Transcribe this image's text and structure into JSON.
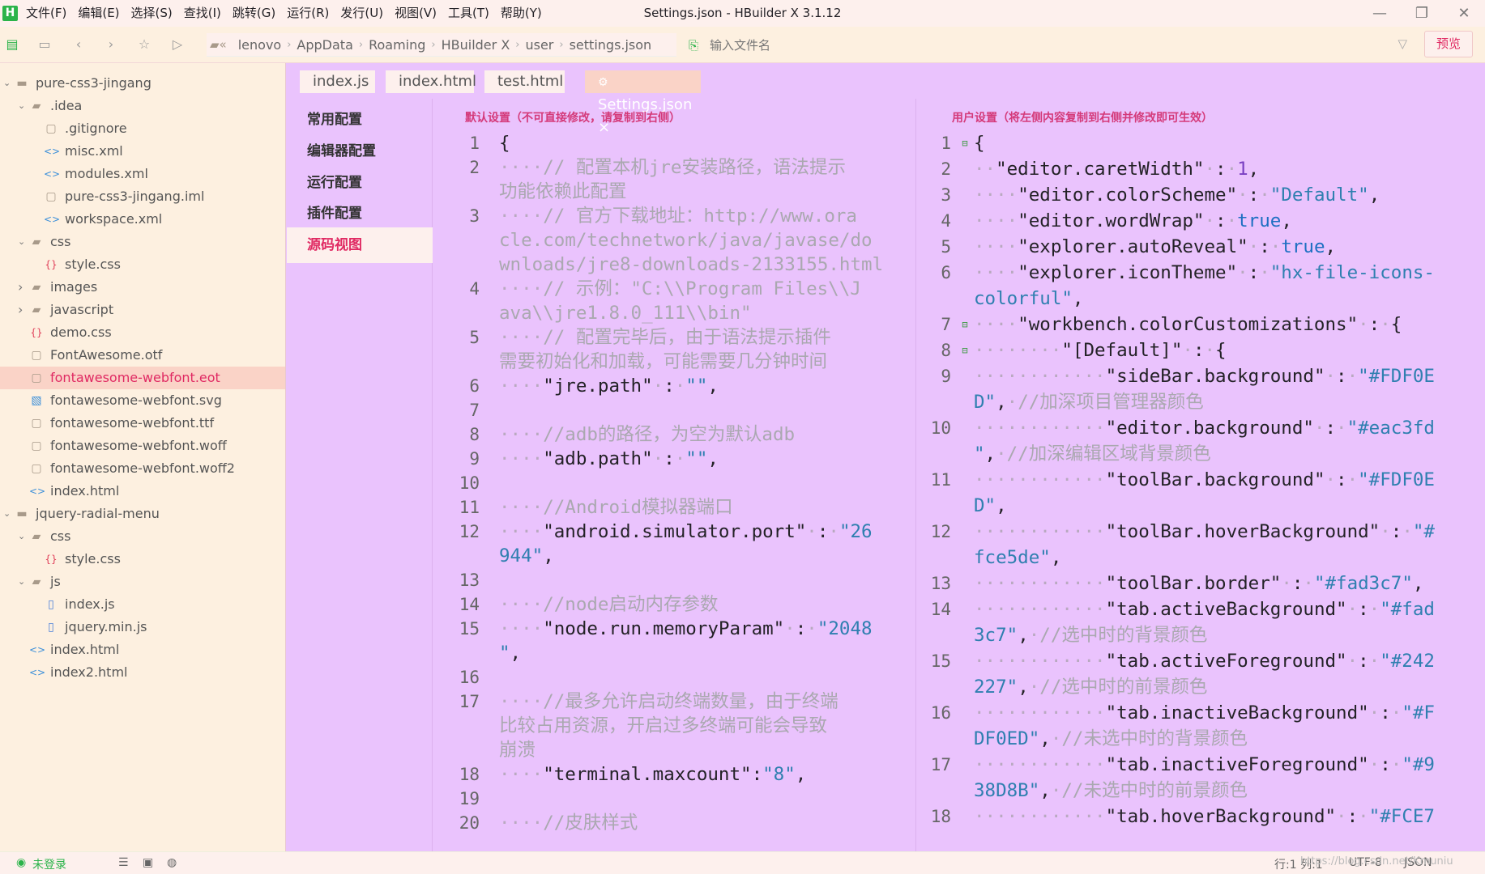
{
  "app": {
    "logo": "H",
    "title": "Settings.json - HBuilder X 3.1.12"
  },
  "menu": [
    "文件(F)",
    "编辑(E)",
    "选择(S)",
    "查找(I)",
    "跳转(G)",
    "运行(R)",
    "发行(U)",
    "视图(V)",
    "工具(T)",
    "帮助(Y)"
  ],
  "breadcrumb": [
    "lenovo",
    "AppData",
    "Roaming",
    "HBuilder X",
    "user",
    "settings.json"
  ],
  "search_placeholder": "输入文件名",
  "preview_label": "预览",
  "tree": [
    {
      "label": "pure-css3-jingang",
      "depth": 0,
      "type": "project",
      "open": true
    },
    {
      "label": ".idea",
      "depth": 1,
      "type": "folder",
      "open": true
    },
    {
      "label": ".gitignore",
      "depth": 2,
      "type": "file"
    },
    {
      "label": "misc.xml",
      "depth": 2,
      "type": "code"
    },
    {
      "label": "modules.xml",
      "depth": 2,
      "type": "code"
    },
    {
      "label": "pure-css3-jingang.iml",
      "depth": 2,
      "type": "file"
    },
    {
      "label": "workspace.xml",
      "depth": 2,
      "type": "code"
    },
    {
      "label": "css",
      "depth": 1,
      "type": "folder",
      "open": true
    },
    {
      "label": "style.css",
      "depth": 2,
      "type": "css"
    },
    {
      "label": "images",
      "depth": 1,
      "type": "folder",
      "open": false
    },
    {
      "label": "javascript",
      "depth": 1,
      "type": "folder",
      "open": false
    },
    {
      "label": "demo.css",
      "depth": 1,
      "type": "css"
    },
    {
      "label": "FontAwesome.otf",
      "depth": 1,
      "type": "file"
    },
    {
      "label": "fontawesome-webfont.eot",
      "depth": 1,
      "type": "file",
      "selected": true
    },
    {
      "label": "fontawesome-webfont.svg",
      "depth": 1,
      "type": "image"
    },
    {
      "label": "fontawesome-webfont.ttf",
      "depth": 1,
      "type": "file"
    },
    {
      "label": "fontawesome-webfont.woff",
      "depth": 1,
      "type": "file"
    },
    {
      "label": "fontawesome-webfont.woff2",
      "depth": 1,
      "type": "file"
    },
    {
      "label": "index.html",
      "depth": 1,
      "type": "code"
    },
    {
      "label": "jquery-radial-menu",
      "depth": 0,
      "type": "project",
      "open": true
    },
    {
      "label": "css",
      "depth": 1,
      "type": "folder",
      "open": true
    },
    {
      "label": "style.css",
      "depth": 2,
      "type": "css"
    },
    {
      "label": "js",
      "depth": 1,
      "type": "folder",
      "open": true
    },
    {
      "label": "index.js",
      "depth": 2,
      "type": "js"
    },
    {
      "label": "jquery.min.js",
      "depth": 2,
      "type": "js"
    },
    {
      "label": "index.html",
      "depth": 1,
      "type": "code"
    },
    {
      "label": "index2.html",
      "depth": 1,
      "type": "code"
    }
  ],
  "tabs": [
    {
      "label": "index.js"
    },
    {
      "label": "index.html"
    },
    {
      "label": "test.html"
    },
    {
      "label": "Settings.json",
      "active": true,
      "icon": "⚙",
      "close": "×"
    }
  ],
  "nav": [
    {
      "label": "常用配置"
    },
    {
      "label": "编辑器配置"
    },
    {
      "label": "运行配置"
    },
    {
      "label": "插件配置"
    },
    {
      "label": "源码视图",
      "active": true
    }
  ],
  "left_title": "默认设置（不可直接修改，请复制到右侧）",
  "right_title": "用户设置（将左侧内容复制到右侧并修改即可生效）",
  "status": {
    "login": "未登录",
    "position": "行:1  列:1",
    "encoding": "UTF-8",
    "syntax": "JSON",
    "watermark": "https://blog.csdn.net/Kmuniu"
  },
  "colors": {
    "sidebar_bg": "#FDF0E0",
    "editor_bg": "#eac3fd",
    "toolbar_bg": "#FDF0E0",
    "hover_bg": "#fce5de",
    "border": "#fad3c7",
    "active_bg": "#fad3c7",
    "active_fg": "#242227",
    "inactive_bg": "#FDF0ED",
    "inactive_fg": "#938D8B",
    "accent": "#e02a63"
  },
  "left_code": [
    {
      "n": "1",
      "parts": [
        [
          "g",
          "{"
        ]
      ]
    },
    {
      "n": "2",
      "parts": [
        [
          "d",
          "····"
        ],
        [
          "c",
          "// 配置本机jre安装路径，语法提示"
        ]
      ]
    },
    {
      "parts": [
        [
          "c",
          "功能依赖此配置"
        ]
      ]
    },
    {
      "n": "3",
      "parts": [
        [
          "d",
          "····"
        ],
        [
          "c",
          "// 官方下载地址：http://www.ora"
        ]
      ]
    },
    {
      "parts": [
        [
          "c",
          "cle.com/technetwork/java/javase/do"
        ]
      ]
    },
    {
      "parts": [
        [
          "c",
          "wnloads/jre8-downloads-2133155.html"
        ]
      ]
    },
    {
      "n": "4",
      "parts": [
        [
          "d",
          "····"
        ],
        [
          "c",
          "// 示例：\"C:\\\\Program Files\\\\J"
        ]
      ]
    },
    {
      "parts": [
        [
          "c",
          "ava\\\\jre1.8.0_111\\\\bin\""
        ]
      ]
    },
    {
      "n": "5",
      "parts": [
        [
          "d",
          "····"
        ],
        [
          "c",
          "// 配置完毕后，由于语法提示插件"
        ]
      ]
    },
    {
      "parts": [
        [
          "c",
          "需要初始化和加载，可能需要几分钟时间"
        ]
      ]
    },
    {
      "n": "6",
      "parts": [
        [
          "d",
          "····"
        ],
        [
          "g",
          "\"jre.path\""
        ],
        [
          "d",
          "·"
        ],
        [
          "g",
          ":"
        ],
        [
          "d",
          "·"
        ],
        [
          "s",
          "\"\""
        ],
        [
          "g",
          ","
        ]
      ]
    },
    {
      "n": "7",
      "parts": []
    },
    {
      "n": "8",
      "parts": [
        [
          "d",
          "····"
        ],
        [
          "c",
          "//adb的路径，为空为默认adb"
        ]
      ]
    },
    {
      "n": "9",
      "parts": [
        [
          "d",
          "····"
        ],
        [
          "g",
          "\"adb.path\""
        ],
        [
          "d",
          "·"
        ],
        [
          "g",
          ":"
        ],
        [
          "d",
          "·"
        ],
        [
          "s",
          "\"\""
        ],
        [
          "g",
          ","
        ]
      ]
    },
    {
      "n": "10",
      "parts": []
    },
    {
      "n": "11",
      "parts": [
        [
          "d",
          "····"
        ],
        [
          "c",
          "//Android模拟器端口"
        ]
      ]
    },
    {
      "n": "12",
      "parts": [
        [
          "d",
          "····"
        ],
        [
          "g",
          "\"android.simulator.port\""
        ],
        [
          "d",
          "·"
        ],
        [
          "g",
          ":"
        ],
        [
          "d",
          "·"
        ],
        [
          "s",
          "\"26"
        ]
      ]
    },
    {
      "parts": [
        [
          "s",
          "944\""
        ],
        [
          "g",
          ","
        ]
      ]
    },
    {
      "n": "13",
      "parts": []
    },
    {
      "n": "14",
      "parts": [
        [
          "d",
          "····"
        ],
        [
          "c",
          "//node启动内存参数"
        ]
      ]
    },
    {
      "n": "15",
      "parts": [
        [
          "d",
          "····"
        ],
        [
          "g",
          "\"node.run.memoryParam\""
        ],
        [
          "d",
          "·"
        ],
        [
          "g",
          ":"
        ],
        [
          "d",
          "·"
        ],
        [
          "s",
          "\"2048"
        ]
      ]
    },
    {
      "parts": [
        [
          "s",
          "\""
        ],
        [
          "g",
          ","
        ]
      ]
    },
    {
      "n": "16",
      "parts": []
    },
    {
      "n": "17",
      "parts": [
        [
          "d",
          "····"
        ],
        [
          "c",
          "//最多允许启动终端数量，由于终端"
        ]
      ]
    },
    {
      "parts": [
        [
          "c",
          "比较占用资源，开启过多终端可能会导致"
        ]
      ]
    },
    {
      "parts": [
        [
          "c",
          "崩溃"
        ]
      ]
    },
    {
      "n": "18",
      "parts": [
        [
          "d",
          "····"
        ],
        [
          "g",
          "\"terminal.maxcount\""
        ],
        [
          "g",
          ":"
        ],
        [
          "s",
          "\"8\""
        ],
        [
          "g",
          ","
        ]
      ]
    },
    {
      "n": "19",
      "parts": []
    },
    {
      "n": "20",
      "parts": [
        [
          "d",
          "····"
        ],
        [
          "c",
          "//皮肤样式"
        ]
      ]
    }
  ],
  "right_code": [
    {
      "n": "1",
      "f": "⊟",
      "parts": [
        [
          "g",
          "{"
        ]
      ]
    },
    {
      "n": "2",
      "parts": [
        [
          "d",
          "··"
        ],
        [
          "g",
          "\"editor.caretWidth\""
        ],
        [
          "d",
          "·"
        ],
        [
          "g",
          ":"
        ],
        [
          "d",
          "·"
        ],
        [
          "n",
          "1"
        ],
        [
          "g",
          ","
        ]
      ]
    },
    {
      "n": "3",
      "parts": [
        [
          "d",
          "····"
        ],
        [
          "g",
          "\"editor.colorScheme\""
        ],
        [
          "d",
          "·"
        ],
        [
          "g",
          ":"
        ],
        [
          "d",
          "·"
        ],
        [
          "s",
          "\"Default\""
        ],
        [
          "g",
          ","
        ]
      ]
    },
    {
      "n": "4",
      "parts": [
        [
          "d",
          "····"
        ],
        [
          "g",
          "\"editor.wordWrap\""
        ],
        [
          "d",
          "·"
        ],
        [
          "g",
          ":"
        ],
        [
          "d",
          "·"
        ],
        [
          "k",
          "true"
        ],
        [
          "g",
          ","
        ]
      ]
    },
    {
      "n": "5",
      "parts": [
        [
          "d",
          "····"
        ],
        [
          "g",
          "\"explorer.autoReveal\""
        ],
        [
          "d",
          "·"
        ],
        [
          "g",
          ":"
        ],
        [
          "d",
          "·"
        ],
        [
          "k",
          "true"
        ],
        [
          "g",
          ","
        ]
      ]
    },
    {
      "n": "6",
      "parts": [
        [
          "d",
          "····"
        ],
        [
          "g",
          "\"explorer.iconTheme\""
        ],
        [
          "d",
          "·"
        ],
        [
          "g",
          ":"
        ],
        [
          "d",
          "·"
        ],
        [
          "s",
          "\"hx-file-icons-"
        ]
      ]
    },
    {
      "parts": [
        [
          "s",
          "colorful\""
        ],
        [
          "g",
          ","
        ]
      ]
    },
    {
      "n": "7",
      "f": "⊟",
      "parts": [
        [
          "d",
          "····"
        ],
        [
          "g",
          "\"workbench.colorCustomizations\""
        ],
        [
          "d",
          "·"
        ],
        [
          "g",
          ":"
        ],
        [
          "d",
          "·"
        ],
        [
          "g",
          "{"
        ]
      ]
    },
    {
      "n": "8",
      "f": "⊟",
      "parts": [
        [
          "d",
          "········"
        ],
        [
          "g",
          "\"[Default]\""
        ],
        [
          "d",
          "·"
        ],
        [
          "g",
          ":"
        ],
        [
          "d",
          "·"
        ],
        [
          "g",
          "{"
        ]
      ]
    },
    {
      "n": "9",
      "parts": [
        [
          "d",
          "············"
        ],
        [
          "g",
          "\"sideBar.background\""
        ],
        [
          "d",
          "·"
        ],
        [
          "g",
          ":"
        ],
        [
          "d",
          "·"
        ],
        [
          "s",
          "\"#FDF0E"
        ]
      ]
    },
    {
      "parts": [
        [
          "s",
          "D\""
        ],
        [
          "g",
          ","
        ],
        [
          "d",
          "·"
        ],
        [
          "c",
          "//加深项目管理器颜色"
        ]
      ]
    },
    {
      "n": "10",
      "parts": [
        [
          "d",
          "············"
        ],
        [
          "g",
          "\"editor.background\""
        ],
        [
          "d",
          "·"
        ],
        [
          "g",
          ":"
        ],
        [
          "d",
          "·"
        ],
        [
          "s",
          "\"#eac3fd"
        ]
      ]
    },
    {
      "parts": [
        [
          "s",
          "\""
        ],
        [
          "g",
          ","
        ],
        [
          "d",
          "·"
        ],
        [
          "c",
          "//加深编辑区域背景颜色"
        ]
      ]
    },
    {
      "n": "11",
      "parts": [
        [
          "d",
          "············"
        ],
        [
          "g",
          "\"toolBar.background\""
        ],
        [
          "d",
          "·"
        ],
        [
          "g",
          ":"
        ],
        [
          "d",
          "·"
        ],
        [
          "s",
          "\"#FDF0E"
        ]
      ]
    },
    {
      "parts": [
        [
          "s",
          "D\""
        ],
        [
          "g",
          ","
        ]
      ]
    },
    {
      "n": "12",
      "parts": [
        [
          "d",
          "············"
        ],
        [
          "g",
          "\"toolBar.hoverBackground\""
        ],
        [
          "d",
          "·"
        ],
        [
          "g",
          ":"
        ],
        [
          "d",
          "·"
        ],
        [
          "s",
          "\"#"
        ]
      ]
    },
    {
      "parts": [
        [
          "s",
          "fce5de\""
        ],
        [
          "g",
          ","
        ]
      ]
    },
    {
      "n": "13",
      "parts": [
        [
          "d",
          "············"
        ],
        [
          "g",
          "\"toolBar.border\""
        ],
        [
          "d",
          "·"
        ],
        [
          "g",
          ":"
        ],
        [
          "d",
          "·"
        ],
        [
          "s",
          "\"#fad3c7\""
        ],
        [
          "g",
          ","
        ]
      ]
    },
    {
      "n": "14",
      "parts": [
        [
          "d",
          "············"
        ],
        [
          "g",
          "\"tab.activeBackground\""
        ],
        [
          "d",
          "·"
        ],
        [
          "g",
          ":"
        ],
        [
          "d",
          "·"
        ],
        [
          "s",
          "\"#fad"
        ]
      ]
    },
    {
      "parts": [
        [
          "s",
          "3c7\""
        ],
        [
          "g",
          ","
        ],
        [
          "d",
          "·"
        ],
        [
          "c",
          "//选中时的背景颜色"
        ]
      ]
    },
    {
      "n": "15",
      "parts": [
        [
          "d",
          "············"
        ],
        [
          "g",
          "\"tab.activeForeground\""
        ],
        [
          "d",
          "·"
        ],
        [
          "g",
          ":"
        ],
        [
          "d",
          "·"
        ],
        [
          "s",
          "\"#242"
        ]
      ]
    },
    {
      "parts": [
        [
          "s",
          "227\""
        ],
        [
          "g",
          ","
        ],
        [
          "d",
          "·"
        ],
        [
          "c",
          "//选中时的前景颜色"
        ]
      ]
    },
    {
      "n": "16",
      "parts": [
        [
          "d",
          "············"
        ],
        [
          "g",
          "\"tab.inactiveBackground\""
        ],
        [
          "d",
          "·"
        ],
        [
          "g",
          ":"
        ],
        [
          "d",
          "·"
        ],
        [
          "s",
          "\"#F"
        ]
      ]
    },
    {
      "parts": [
        [
          "s",
          "DF0ED\""
        ],
        [
          "g",
          ","
        ],
        [
          "d",
          "·"
        ],
        [
          "c",
          "//未选中时的背景颜色"
        ]
      ]
    },
    {
      "n": "17",
      "parts": [
        [
          "d",
          "············"
        ],
        [
          "g",
          "\"tab.inactiveForeground\""
        ],
        [
          "d",
          "·"
        ],
        [
          "g",
          ":"
        ],
        [
          "d",
          "·"
        ],
        [
          "s",
          "\"#9"
        ]
      ]
    },
    {
      "parts": [
        [
          "s",
          "38D8B\""
        ],
        [
          "g",
          ","
        ],
        [
          "d",
          "·"
        ],
        [
          "c",
          "//未选中时的前景颜色"
        ]
      ]
    },
    {
      "n": "18",
      "parts": [
        [
          "d",
          "············"
        ],
        [
          "g",
          "\"tab.hoverBackground\""
        ],
        [
          "d",
          "·"
        ],
        [
          "g",
          ":"
        ],
        [
          "d",
          "·"
        ],
        [
          "s",
          "\"#FCE7"
        ]
      ]
    }
  ]
}
